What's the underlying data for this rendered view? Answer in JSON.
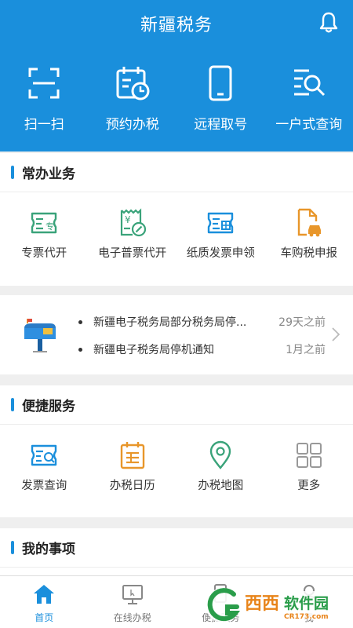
{
  "header": {
    "title": "新疆税务",
    "bell_icon": "bell-icon"
  },
  "quick_actions": [
    {
      "label": "扫一扫",
      "icon": "scan-icon"
    },
    {
      "label": "预约办税",
      "icon": "calendar-clock-icon"
    },
    {
      "label": "远程取号",
      "icon": "phone-icon"
    },
    {
      "label": "一户式查询",
      "icon": "search-list-icon"
    }
  ],
  "common_services": {
    "title": "常办业务",
    "items": [
      {
        "label": "专票代开",
        "icon": "special-invoice-icon"
      },
      {
        "label": "电子普票代开",
        "icon": "e-invoice-icon"
      },
      {
        "label": "纸质发票申领",
        "icon": "paper-invoice-icon"
      },
      {
        "label": "车购税申报",
        "icon": "car-tax-icon"
      }
    ]
  },
  "notices": [
    {
      "text": "新疆电子税务局部分税务局停...",
      "time": "29天之前"
    },
    {
      "text": "新疆电子税务局停机通知",
      "time": "1月之前"
    }
  ],
  "convenient_services": {
    "title": "便捷服务",
    "items": [
      {
        "label": "发票查询",
        "icon": "invoice-search-icon"
      },
      {
        "label": "办税日历",
        "icon": "tax-calendar-icon"
      },
      {
        "label": "办税地图",
        "icon": "map-pin-icon"
      },
      {
        "label": "更多",
        "icon": "more-grid-icon"
      }
    ]
  },
  "my_items": {
    "title": "我的事项"
  },
  "tabbar": [
    {
      "label": "首页",
      "icon": "home-icon",
      "active": true
    },
    {
      "label": "在线办税",
      "icon": "monitor-icon",
      "active": false
    },
    {
      "label": "便捷服务",
      "icon": "service-icon",
      "active": false
    },
    {
      "label": "我",
      "icon": "person-icon",
      "active": false
    }
  ],
  "watermark": {
    "brand": "西西",
    "site": "软件园",
    "url": "CR173.com"
  },
  "colors": {
    "primary": "#1a8fdc",
    "green": "#3aa37a",
    "orange": "#e8962a"
  }
}
